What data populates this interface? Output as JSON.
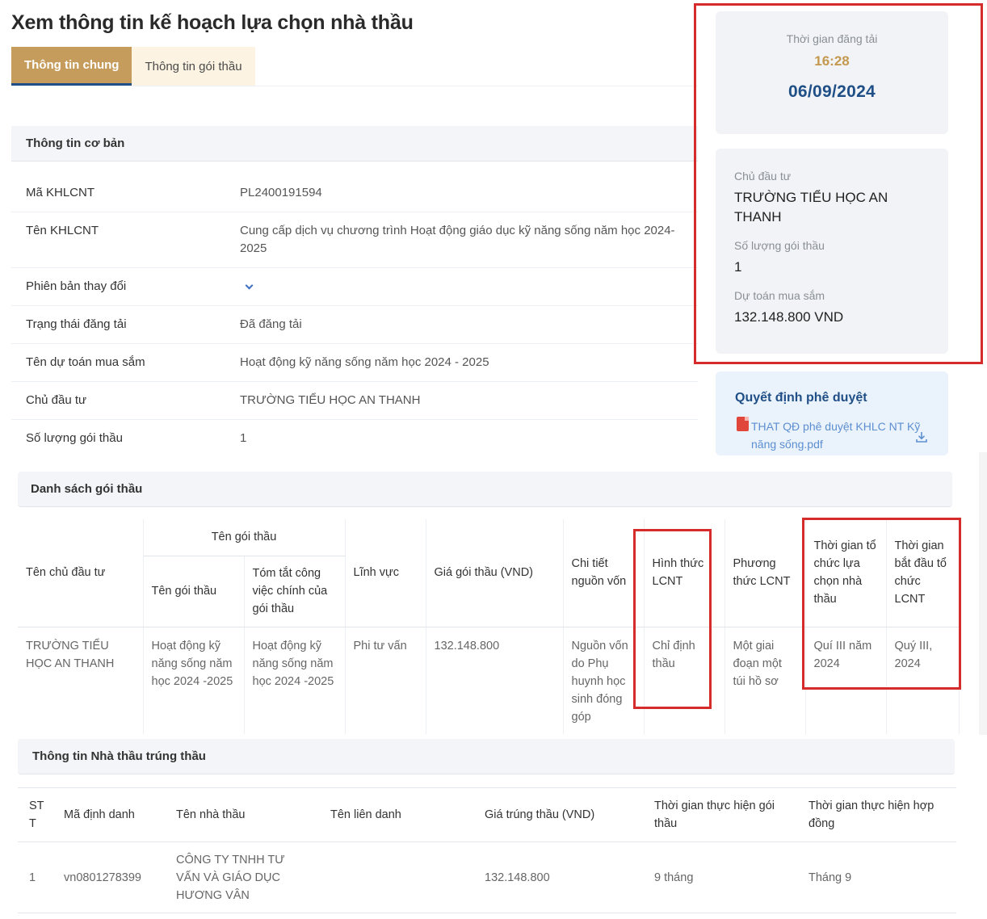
{
  "page": {
    "title": "Xem thông tin kế hoạch lựa chọn nhà thầu"
  },
  "tabs": [
    {
      "label": "Thông tin chung",
      "active": true
    },
    {
      "label": "Thông tin gói thầu",
      "active": false
    }
  ],
  "basic_info": {
    "heading": "Thông tin cơ bản",
    "rows": [
      {
        "label": "Mã KHLCNT",
        "value": "PL2400191594"
      },
      {
        "label": "Tên KHLCNT",
        "value": "Cung cấp dịch vụ chương trình Hoạt động giáo dục kỹ năng sống năm học 2024-2025"
      },
      {
        "label": "Phiên bản thay đổi",
        "value": ""
      },
      {
        "label": "Trạng thái đăng tải",
        "value": "Đã đăng tải"
      },
      {
        "label": "Tên dự toán mua sắm",
        "value": "Hoạt động kỹ năng sống năm học 2024 - 2025"
      },
      {
        "label": "Chủ đầu tư",
        "value": "TRƯỜNG TIỂU HỌC AN THANH"
      },
      {
        "label": "Số lượng gói thầu",
        "value": "1"
      }
    ]
  },
  "summary": {
    "posted_label": "Thời gian đăng tải",
    "posted_time": "16:28",
    "posted_date": "06/09/2024",
    "investor_label": "Chủ đầu tư",
    "investor_value": "TRƯỜNG TIỂU HỌC AN THANH",
    "package_count_label": "Số lượng gói thầu",
    "package_count_value": "1",
    "budget_label": "Dự toán mua sắm",
    "budget_value": "132.148.800 VND"
  },
  "decision": {
    "title": "Quyết định phê duyệt",
    "file": "THAT QĐ phê duyệt KHLC NT Kỹ năng sống.pdf",
    "file_icon": "pdf-icon",
    "download_icon": "download-icon"
  },
  "packages": {
    "heading": "Danh sách gói thầu",
    "headers": {
      "investor": "Tên chủ đầu tư",
      "package_group": "Tên gói thầu",
      "package_name": "Tên gói thầu",
      "summary": "Tóm tắt công việc chính của gói thầu",
      "field": "Lĩnh vực",
      "price": "Giá gói thầu (VND)",
      "funding": "Chi tiết nguồn vốn",
      "form": "Hình thức LCNT",
      "method": "Phương thức LCNT",
      "org_time": "Thời gian tổ chức lựa chọn nhà thầu",
      "start_time": "Thời gian bắt đầu tổ chức LCNT"
    },
    "row": {
      "investor": "TRƯỜNG TIỂU HỌC AN THANH",
      "package_name": "Hoạt động kỹ năng sống năm học 2024 -2025",
      "summary": "Hoạt động kỹ năng sống năm học 2024 -2025",
      "field": "Phi tư vấn",
      "price": "132.148.800",
      "funding": "Nguồn vốn do Phụ huynh học sinh đóng góp",
      "form": "Chỉ định thầu",
      "method": "Một giai đoạn một túi hồ sơ",
      "org_time": "Quí III năm 2024",
      "start_time": "Quý III, 2024"
    }
  },
  "winners": {
    "heading": "Thông tin Nhà thầu trúng thầu",
    "headers": {
      "stt": "STT",
      "code": "Mã định danh",
      "name": "Tên nhà thầu",
      "joint": "Tên liên danh",
      "price": "Giá trúng thầu (VND)",
      "pkg_time": "Thời gian thực hiện gói thầu",
      "contract_time": "Thời gian thực hiện hợp đồng"
    },
    "rows": [
      {
        "stt": "1",
        "code": "vn0801278399",
        "name": "CÔNG TY TNHH TƯ VẤN VÀ GIÁO DỤC HƯƠNG VÂN",
        "joint": "",
        "price": "132.148.800",
        "pkg_time": "9 tháng",
        "contract_time": "Tháng 9"
      }
    ]
  },
  "colors": {
    "accent_tab": "#c69c5c",
    "brand_blue": "#1f4f86",
    "highlight_red": "#d62b2b",
    "time_gold": "#c4994f"
  }
}
